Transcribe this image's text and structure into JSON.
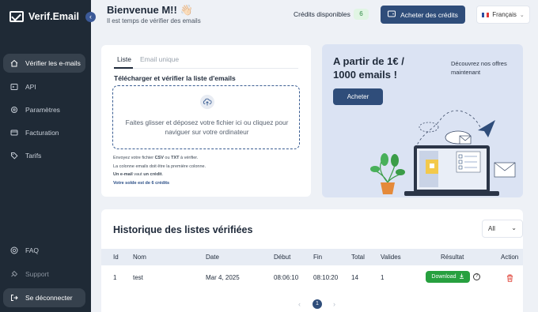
{
  "brand": {
    "name": "Verif.Email"
  },
  "sidebar": {
    "items": [
      {
        "label": "Vérifier les e-mails",
        "icon": "home-icon"
      },
      {
        "label": "API",
        "icon": "code-icon"
      },
      {
        "label": "Paramètres",
        "icon": "gear-icon"
      },
      {
        "label": "Facturation",
        "icon": "card-icon"
      },
      {
        "label": "Tarifs",
        "icon": "tag-icon"
      }
    ],
    "bottom": [
      {
        "label": "FAQ",
        "icon": "help-icon"
      },
      {
        "label": "Support",
        "icon": "support-icon"
      },
      {
        "label": "Se déconnecter",
        "icon": "logout-icon"
      }
    ]
  },
  "header": {
    "welcome": "Bienvenue M!! 👋🏻",
    "subtitle": "Il est temps de vérifier des emails",
    "credits_label": "Crédits disponibles",
    "credits_value": "6",
    "buy_button": "Acheter des crédits",
    "language": "Français"
  },
  "upload": {
    "tabs": [
      "Liste",
      "Email unique"
    ],
    "title": "Télécharger et vérifier la liste d'emails",
    "drop_text": "Faites glisser et déposez votre fichier ici ou cliquez pour naviguer sur votre ordinateur",
    "info1_pre": "Envoyez votre fichier ",
    "info1_csv": "CSV",
    "info1_mid": " ou ",
    "info1_txt": "TXT",
    "info1_post": " à vérifier.",
    "info2": "La colonne emails doit être la première colonne.",
    "info3_a": "Un e-mail",
    "info3_b": " vaut ",
    "info3_c": "un crédit",
    "info3_d": ".",
    "balance": "Votre solde est de 6 crédits"
  },
  "promo": {
    "title": "A partir de 1€ / 1000 emails !",
    "note": "Découvrez nos offres maintenant",
    "button": "Acheter"
  },
  "history": {
    "title": "Historique des listes vérifiées",
    "filter": "All",
    "columns": [
      "Id",
      "Nom",
      "Date",
      "Début",
      "Fin",
      "Total",
      "Valides",
      "Résultat",
      "Action"
    ],
    "rows": [
      {
        "id": "1",
        "name": "test",
        "date": "Mar 4, 2025",
        "start": "08:06:10",
        "end": "08:10:20",
        "total": "14",
        "valid": "1",
        "result": "Download"
      }
    ],
    "pagination": {
      "prev": "‹",
      "current": "1",
      "next": "›"
    }
  },
  "colors": {
    "sidebar": "#1f2a36",
    "accent": "#2f4d7a",
    "success": "#27a03f",
    "danger": "#e0463b",
    "promo_bg": "#dbe3f3"
  }
}
